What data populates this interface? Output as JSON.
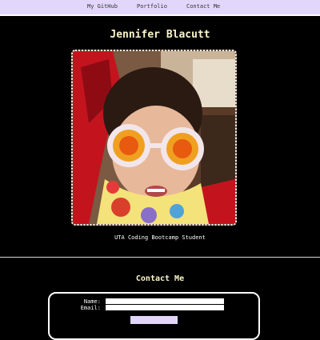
{
  "nav": {
    "links": [
      {
        "label": "My GitHub"
      },
      {
        "label": "Portfolio"
      },
      {
        "label": "Contact Me"
      }
    ]
  },
  "header": {
    "name": "Jennifer Blacutt"
  },
  "profile": {
    "caption": "UTA Coding Bootcamp Student"
  },
  "contact": {
    "title": "Contact Me",
    "name_label": "Name:",
    "email_label": "Email:",
    "name_value": "",
    "email_value": ""
  },
  "colors": {
    "nav_bg": "#e2d6fb",
    "heading": "#fdf6c8",
    "background": "#000000"
  }
}
